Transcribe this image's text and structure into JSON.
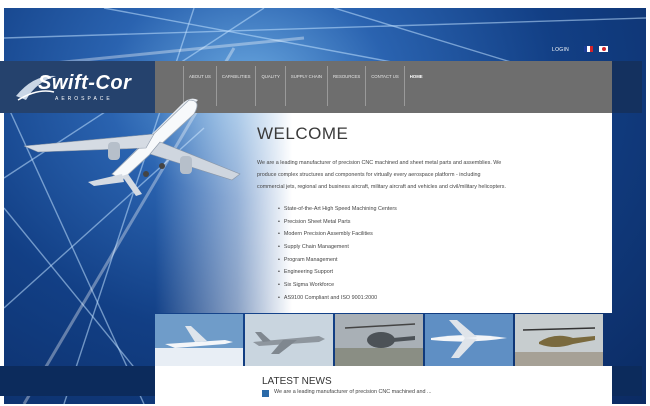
{
  "header": {
    "login_label": "LOGIN",
    "flags": [
      "french-flag",
      "japanese-flag"
    ]
  },
  "logo": {
    "name": "Swift-Cor",
    "tagline": "AEROSPACE"
  },
  "nav": {
    "items": [
      {
        "label": "ABOUT US"
      },
      {
        "label": "CAPABILITIES"
      },
      {
        "label": "QUALITY"
      },
      {
        "label": "SUPPLY CHAIN"
      },
      {
        "label": "RESOURCES"
      },
      {
        "label": "CONTACT US"
      },
      {
        "label": "HOME"
      }
    ],
    "active": "HOME"
  },
  "main": {
    "title": "WELCOME",
    "intro": "We are a leading manufacturer of precision CNC machined and sheet metal parts and assemblies. We produce complex structures and components for virtually every aerospace platform - including commercial jets, regional and business aircraft, military aircraft and vehicles and civil/military helicopters.",
    "bullets": [
      "State-of-the-Art High Speed Machining Centers",
      "Precision Sheet Metal Parts",
      "Modern Precision Assembly Facilities",
      "Supply Chain Management",
      "Program Management",
      "Engineering Support",
      "Six Sigma Workforce",
      "AS9100 Compliant and ISO 9001:2000"
    ]
  },
  "gallery": {
    "items": [
      "business-jet-photo",
      "fighter-jet-photo",
      "helicopter-photo",
      "airliner-photo",
      "attack-helicopter-photo"
    ]
  },
  "news": {
    "title": "LATEST NEWS",
    "item": "We are a leading manufacturer of precision CNC machined and ..."
  },
  "colors": {
    "brand_blue": "#1d4f95",
    "nav_gray": "#6e6e6e",
    "news_icon": "#2b6aa8"
  }
}
